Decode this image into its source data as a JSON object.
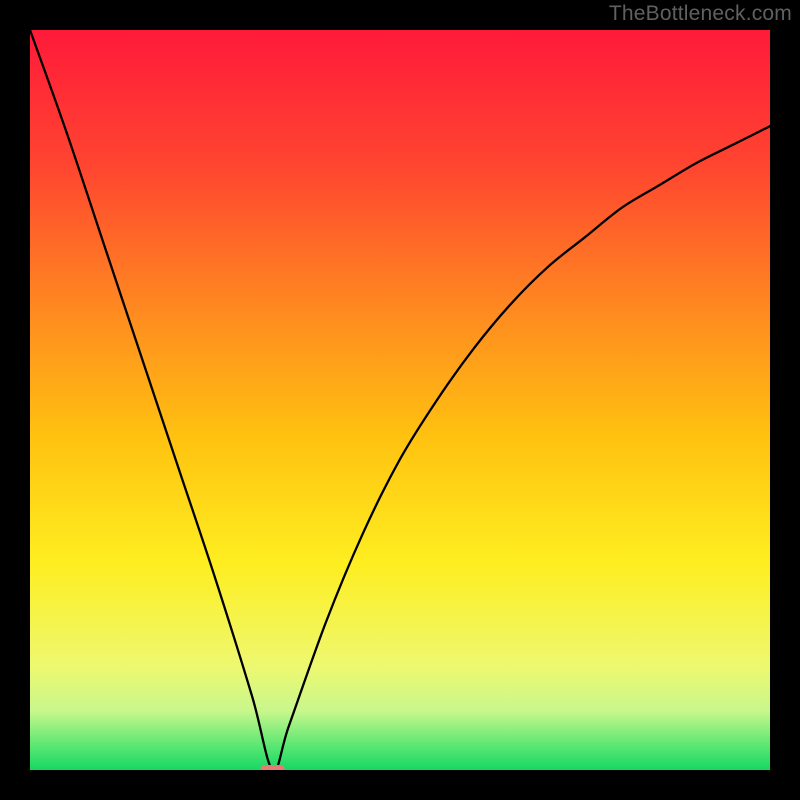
{
  "watermark": "TheBottleneck.com",
  "chart_data": {
    "type": "line",
    "title": "",
    "xlabel": "",
    "ylabel": "",
    "xlim": [
      0,
      100
    ],
    "ylim": [
      0,
      100
    ],
    "x": [
      0,
      5,
      10,
      15,
      20,
      25,
      30,
      32.8,
      35,
      40,
      45,
      50,
      55,
      60,
      65,
      70,
      75,
      80,
      85,
      90,
      95,
      100
    ],
    "values": [
      100,
      86,
      71,
      56,
      41,
      26,
      10,
      0,
      6,
      20,
      32,
      42,
      50,
      57,
      63,
      68,
      72,
      76,
      79,
      82,
      84.5,
      87
    ],
    "gradient_stops": [
      {
        "offset": 0.0,
        "color": "#ff1a3a"
      },
      {
        "offset": 0.18,
        "color": "#ff4430"
      },
      {
        "offset": 0.38,
        "color": "#ff8a20"
      },
      {
        "offset": 0.55,
        "color": "#ffc210"
      },
      {
        "offset": 0.72,
        "color": "#feee20"
      },
      {
        "offset": 0.86,
        "color": "#eef870"
      },
      {
        "offset": 0.92,
        "color": "#c8f78c"
      },
      {
        "offset": 0.965,
        "color": "#5fe874"
      },
      {
        "offset": 1.0,
        "color": "#17d765"
      }
    ],
    "marker": {
      "x": 32.8,
      "y": 0,
      "color": "#e77a77"
    },
    "legend": []
  }
}
